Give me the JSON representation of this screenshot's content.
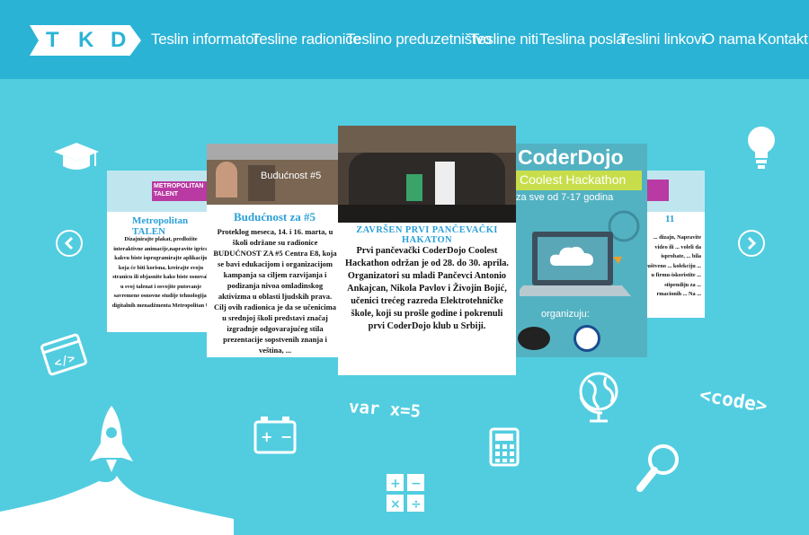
{
  "logo": {
    "letters": [
      "T",
      "K",
      "D"
    ]
  },
  "nav": {
    "items": [
      "Teslin informator",
      "Tesline radionice",
      "Teslino preduzetništvo",
      "Tesline niti",
      "Teslina posla",
      "Teslini linkovi",
      "O nama",
      "Kontakt"
    ]
  },
  "decor": {
    "var_text": "var x=5",
    "code_text": "<code>"
  },
  "carousel": {
    "left_card": {
      "image_text": "METROPOLITAN TALENT",
      "title": "Metropolitan TALEN",
      "body": "Dizajnirajte plakat, predložite interaktivne animacije,napravite igricu kakvu biste isprogramirajte aplikaciju koja će biti korisna, kreirajte svoju stranicu ili objasnite kako biste osnovali u svoj talenat i osvojite putovanje savremene osnovne studije tehnologija, digitalnih menadžmenta Metropolitan U"
    },
    "second_card": {
      "image_caption": "Budućnost #5",
      "title": "Budućnost za #5",
      "body": "Proteklog meseca, 14. i 16. marta, u školi održane su radionice BUDUĆNOST ZA #5 Centra E8, koja se bavi edukacijom i organizacijom kampanja sa ciljem razvijanja i podizanja nivoa omladinskog aktivizma u oblasti ljudskih prava. Cilj ovih radionica je da se učenicima u srednjoj školi predstavi značaj izgradnje odgovarajućeg stila prezentacije sopstvenih znanja i veština, ..."
    },
    "main_card": {
      "title": "ZAVRŠEN PRVI PANČEVAČKI HAKATON",
      "body": "Prvi pančevački CoderDojo Coolest Hackathon održan je od 28. do 30. aprila. Organizatori su mladi Pančevci Antonio Ankajcan, Nikola Pavlov i Živojin Bojić, učenici trećeg razreda Elektrotehničke škole, koji su prošle godine i pokrenuli prvi CoderDojo klub u Srbiji."
    },
    "coderdojo_card": {
      "title": "CoderDojo",
      "banner": "Coolest Hackathon",
      "ages": "za sve od 7-17 godina",
      "organizers_label": "organizuju:"
    },
    "right_card": {
      "image_text": "11",
      "body": "... dizajn, Napravite video ili ... voleli da isprobate, ... bila društveno ... kolekciju ... u firmu-iskoristite ... stipendiju za ... rmacionih ... Na ..."
    }
  }
}
